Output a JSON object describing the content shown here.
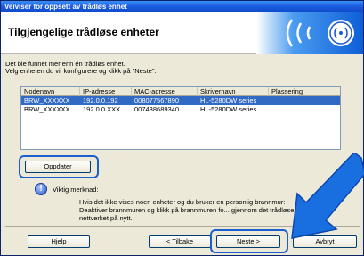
{
  "window": {
    "title": "Veiviser for oppsett av trådløs enhet"
  },
  "header": {
    "title": "Tilgjengelige trådløse enheter",
    "logo_icon": "wifi-signal-icon"
  },
  "intro": {
    "line1": "Det ble funnet mer enn én trådløs enhet.",
    "line2": "Velg enheten du vil konfigurere og klikk på \"Neste\"."
  },
  "table": {
    "columns": [
      "Nodenavn",
      "IP-adresse",
      "MAC-adresse",
      "Skrivernavn",
      "Plassering"
    ],
    "rows": [
      [
        "BRW_XXXXXX",
        "192.0.0.192",
        "008077567890",
        "HL-5280DW series",
        ""
      ],
      [
        "BRW_XXXXXX",
        "192.0.0.XXX",
        "007438689340",
        "HL-5280DW series",
        ""
      ]
    ],
    "selected_row": 0
  },
  "buttons": {
    "refresh": "Oppdater",
    "help": "Hjelp",
    "back": "< Tilbake",
    "next": "Neste >",
    "cancel": "Avbryt"
  },
  "note": {
    "title": "Viktig merknad:",
    "text": "Hvis det ikke vises noen enheter og du bruker en personlig brannmur: Deaktiver brannmuren og klikk på brannmuren fo... gjennom det trådløse nettverket på nytt."
  },
  "colors": {
    "highlight": "#1a5fd0",
    "selection": "#316ac5",
    "titlebar": "#1c5ee0"
  }
}
